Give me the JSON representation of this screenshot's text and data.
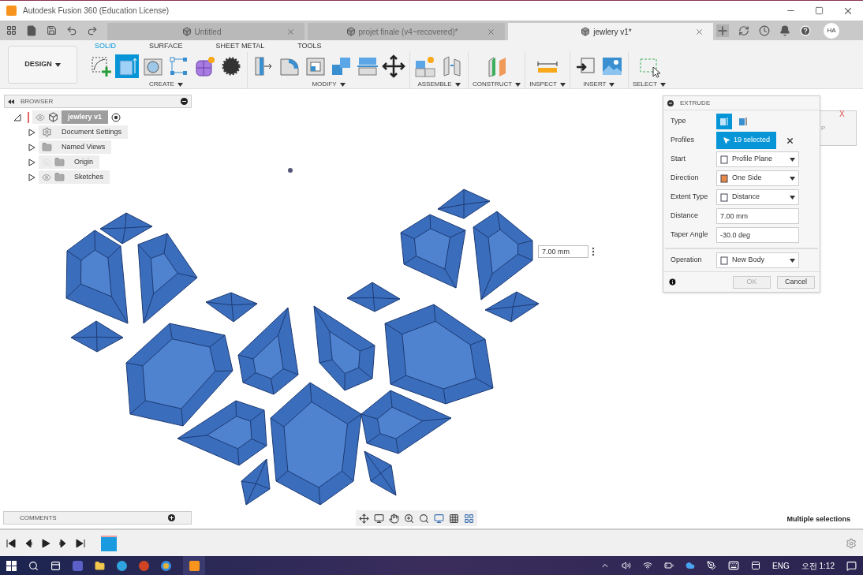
{
  "window": {
    "title": "Autodesk Fusion 360 (Education License)"
  },
  "document_tabs": [
    {
      "label": "Untitled",
      "selected": false
    },
    {
      "label": "projet finale (v4~recovered)*",
      "selected": false
    },
    {
      "label": "jewlery v1*",
      "selected": true
    }
  ],
  "avatar": "HA",
  "workspace_button": "DESIGN",
  "ribbon_tabs": [
    {
      "label": "SOLID",
      "selected": true
    },
    {
      "label": "SURFACE",
      "selected": false
    },
    {
      "label": "SHEET METAL",
      "selected": false
    },
    {
      "label": "TOOLS",
      "selected": false
    }
  ],
  "ribbon_groups": [
    {
      "label": "CREATE",
      "tools": [
        {
          "active": false
        },
        {
          "active": true
        },
        {
          "active": false
        },
        {
          "active": false
        },
        {
          "active": false
        },
        {
          "active": false
        }
      ]
    },
    {
      "label": "MODIFY",
      "tools": [
        {
          "active": false
        },
        {
          "active": false
        },
        {
          "active": false
        },
        {
          "active": false
        },
        {
          "active": false
        },
        {
          "active": false
        }
      ]
    },
    {
      "label": "ASSEMBLE",
      "tools": [
        {
          "active": false
        },
        {
          "active": false
        }
      ]
    },
    {
      "label": "CONSTRUCT",
      "tools": [
        {
          "active": false
        }
      ]
    },
    {
      "label": "INSPECT",
      "tools": [
        {
          "active": false
        }
      ]
    },
    {
      "label": "INSERT",
      "tools": [
        {
          "active": false
        },
        {
          "active": false
        }
      ]
    },
    {
      "label": "SELECT",
      "tools": [
        {
          "active": false
        }
      ]
    }
  ],
  "browser": {
    "title": "BROWSER",
    "items": [
      {
        "label": "jewlery v1",
        "kind": "component",
        "selected": true,
        "expanded": true,
        "visible": true,
        "children": [
          {
            "label": "Document Settings",
            "kind": "settings",
            "selected": false,
            "expanded": false
          },
          {
            "label": "Named Views",
            "kind": "views",
            "selected": false,
            "expanded": false
          },
          {
            "label": "Origin",
            "kind": "folder",
            "selected": false,
            "expanded": false,
            "visible": false
          },
          {
            "label": "Sketches",
            "kind": "folder",
            "selected": false,
            "expanded": false,
            "visible": true
          }
        ]
      }
    ]
  },
  "extrude": {
    "title": "EXTRUDE",
    "rows": [
      {
        "label": "Type",
        "kind": "type",
        "options": [
          {
            "selected": true
          },
          {
            "selected": false
          }
        ]
      },
      {
        "label": "Profiles",
        "kind": "selection",
        "value": "19 selected"
      },
      {
        "label": "Start",
        "kind": "dropdown",
        "value": "Profile Plane"
      },
      {
        "label": "Direction",
        "kind": "dropdown",
        "value": "One Side"
      },
      {
        "label": "Extent Type",
        "kind": "dropdown",
        "value": "Distance"
      },
      {
        "label": "Distance",
        "kind": "input",
        "value": "7.00 mm"
      },
      {
        "label": "Taper Angle",
        "kind": "input",
        "value": "-30.0 deg"
      },
      {
        "label": "Operation",
        "kind": "dropdown",
        "value": "New Body"
      }
    ],
    "buttons": [
      {
        "label": "OK",
        "disabled": true
      },
      {
        "label": "Cancel",
        "disabled": false
      }
    ]
  },
  "dimension_input": {
    "value": "7.00 mm"
  },
  "viewcube": {
    "face_label": "P",
    "axis_label": "X"
  },
  "comments": {
    "title": "COMMENTS"
  },
  "status": "Multiple selections",
  "taskbar": {
    "language": "ENG",
    "clock": "오전 1:12"
  }
}
